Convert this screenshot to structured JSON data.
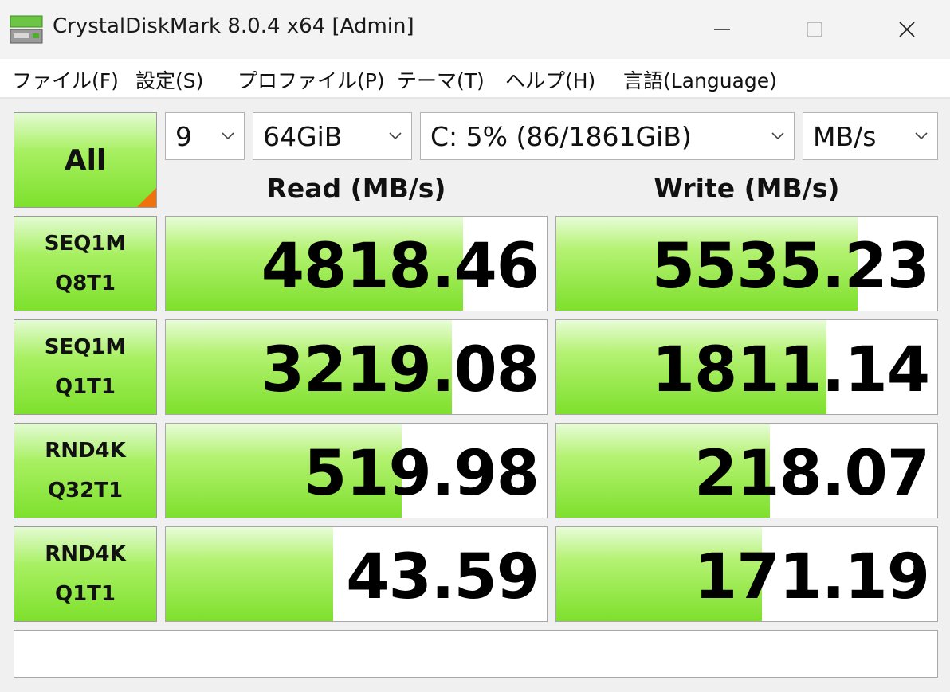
{
  "window": {
    "title": "CrystalDiskMark 8.0.4 x64 [Admin]",
    "icon": "disk-icon",
    "controls": [
      "minimize-icon",
      "maximize-icon",
      "close-icon"
    ]
  },
  "menu": [
    {
      "label": "ファイル(F)"
    },
    {
      "label": "設定(S)"
    },
    {
      "label": "プロファイル(P)"
    },
    {
      "label": "テーマ(T)"
    },
    {
      "label": "ヘルプ(H)"
    },
    {
      "label": "言語(Language)"
    }
  ],
  "controls": {
    "all_label": "All",
    "count": "9",
    "size": "64GiB",
    "drive": "C: 5% (86/1861GiB)",
    "unit": "MB/s"
  },
  "headers": {
    "read": "Read (MB/s)",
    "write": "Write (MB/s)"
  },
  "tests": [
    {
      "line1": "SEQ1M",
      "line2": "Q8T1",
      "read": "4818.46",
      "write": "5535.23",
      "read_fill": 0.78,
      "write_fill": 0.79
    },
    {
      "line1": "SEQ1M",
      "line2": "Q1T1",
      "read": "3219.08",
      "write": "1811.14",
      "read_fill": 0.75,
      "write_fill": 0.71
    },
    {
      "line1": "RND4K",
      "line2": "Q32T1",
      "read": "519.98",
      "write": "218.07",
      "read_fill": 0.62,
      "write_fill": 0.56
    },
    {
      "line1": "RND4K",
      "line2": "Q1T1",
      "read": "43.59",
      "write": "171.19",
      "read_fill": 0.44,
      "write_fill": 0.54
    }
  ],
  "comment": "",
  "colors": {
    "accent_green": "#7ee02c",
    "corner_orange": "#f0720e"
  }
}
